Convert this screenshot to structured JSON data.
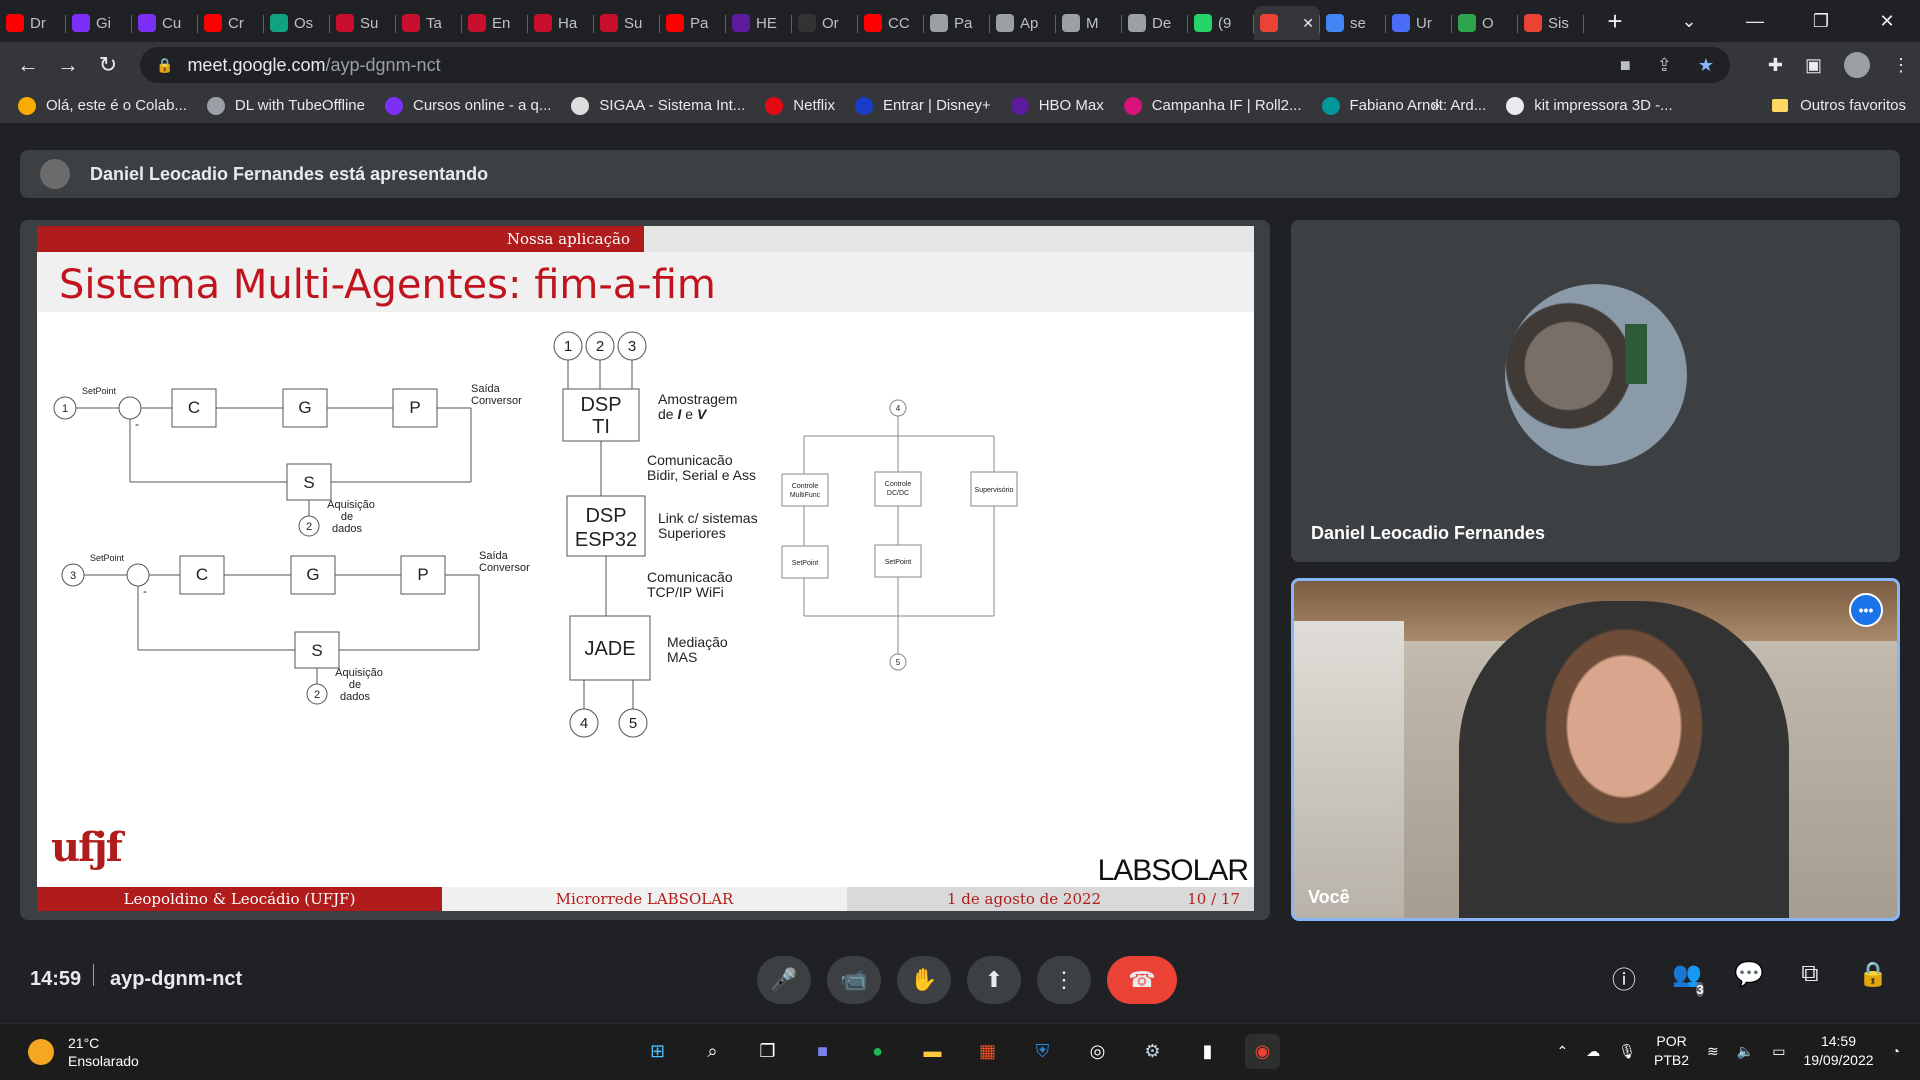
{
  "browser": {
    "tabs": [
      {
        "label": "Dr",
        "color": "#ff0000"
      },
      {
        "label": "Gi",
        "color": "#7b2ff7"
      },
      {
        "label": "Cu",
        "color": "#7b2ff7"
      },
      {
        "label": "Cr",
        "color": "#ff0000"
      },
      {
        "label": "Os",
        "color": "#10a37f"
      },
      {
        "label": "Su",
        "color": "#c8102e"
      },
      {
        "label": "Ta",
        "color": "#c8102e"
      },
      {
        "label": "En",
        "color": "#c8102e"
      },
      {
        "label": "Ha",
        "color": "#c8102e"
      },
      {
        "label": "Su",
        "color": "#c8102e"
      },
      {
        "label": "Pa",
        "color": "#ff0000"
      },
      {
        "label": "HE",
        "color": "#5c1a9d"
      },
      {
        "label": "Or",
        "color": "#333333"
      },
      {
        "label": "CC",
        "color": "#ff0000"
      },
      {
        "label": "Pa",
        "color": "#9aa0a6"
      },
      {
        "label": "Ap",
        "color": "#9aa0a6"
      },
      {
        "label": "M",
        "color": "#9aa0a6"
      },
      {
        "label": "De",
        "color": "#9aa0a6"
      },
      {
        "label": "(9",
        "color": "#25d366"
      },
      {
        "label": "",
        "color": "#ea4335",
        "active": true
      },
      {
        "label": "se",
        "color": "#4285f4"
      },
      {
        "label": "Ur",
        "color": "#4a6cf7"
      },
      {
        "label": "O",
        "color": "#2da44e"
      },
      {
        "label": "Sis",
        "color": "#ea4335"
      }
    ],
    "new_tab": "+",
    "window_controls": [
      "⌄",
      "—",
      "❐",
      "✕"
    ],
    "nav": {
      "back": "←",
      "forward": "→",
      "reload": "↻"
    },
    "url": {
      "host": "meet.google.com",
      "path": "/ayp-dgnm-nct"
    },
    "bookmarks": [
      {
        "label": "Olá, este é o Colab...",
        "color": "#f9ab00"
      },
      {
        "label": "DL with TubeOffline",
        "color": "#9aa0a6"
      },
      {
        "label": "Cursos online - a q...",
        "color": "#7b2ff7"
      },
      {
        "label": "SIGAA - Sistema Int...",
        "color": "#dddddd"
      },
      {
        "label": "Netflix",
        "color": "#e50914"
      },
      {
        "label": "Entrar | Disney+",
        "color": "#1a3cc8"
      },
      {
        "label": "HBO Max",
        "color": "#5c1a9d"
      },
      {
        "label": "Campanha IF | Roll2...",
        "color": "#d8127b"
      },
      {
        "label": "Fabiano Arndt: Ard...",
        "color": "#00979c"
      },
      {
        "label": "kit impressora 3D -...",
        "color": "#e8eaed"
      }
    ],
    "bookmarks_more": "»",
    "other_bookmarks": "Outros favoritos"
  },
  "meet": {
    "presenting_text": "Daniel Leocadio Fernandes está apresentando",
    "slide": {
      "section": "Nossa aplicação",
      "title": "Sistema Multi-Agentes:  fim-a-fim",
      "footer_authors": "Leopoldino & Leocádio  (UFJF)",
      "footer_title": "Microrrede LABSOLAR",
      "footer_date": "1 de agosto de 2022",
      "footer_page": "10 / 17",
      "logo_ufjf": "ufjf",
      "logo_labsolar": "LABSOLAR",
      "diagram": {
        "setpoint": "SetPoint",
        "saida": "Saída",
        "conversor": "Conversor",
        "aquisicao": "Aquisição",
        "de": "de",
        "dados": "dados",
        "block_c": "C",
        "block_g": "G",
        "block_p": "P",
        "block_s": "S",
        "node1": "1",
        "node2": "2",
        "node3": "3",
        "node4": "4",
        "node5": "5",
        "minus": "-",
        "dsp_ti_1": "DSP",
        "dsp_ti_2": "TI",
        "dsp_esp_1": "DSP",
        "dsp_esp_2": "ESP32",
        "jade": "JADE",
        "amostragem_1": "Amostragem",
        "amostragem_2a": "de ",
        "amostragem_i": "I",
        "amostragem_e": " e ",
        "amostragem_v": "V",
        "comun_1a": "Comunicacão",
        "comun_1b": "Bidir, Serial e Ass",
        "link_1": "Link c/ sistemas",
        "link_2": "Superiores",
        "comun_2a": "Comunicacão",
        "comun_2b": "TCP/IP WiFi",
        "mediacao_1": "Mediação",
        "mediacao_2": "MAS",
        "ctrl_multi_1": "Controle",
        "ctrl_multi_2": "MultiFunc",
        "ctrl_dc_1": "Controle",
        "ctrl_dc_2": "DC/DC",
        "supervisorio": "Supervisório",
        "setpoint_small": "SetPoint"
      }
    },
    "speaker_name": "Daniel Leocadio Fernandes",
    "self_name": "Você",
    "time": "14:59",
    "meeting_code": "ayp-dgnm-nct",
    "participants_count": "3",
    "controls": {
      "mic": "🎤",
      "camera": "📹",
      "raise_hand": "✋",
      "present": "⬆",
      "more": "⋮",
      "end_call": "☎"
    },
    "right_icons": {
      "info": "ⓘ",
      "people": "👥",
      "chat": "💬",
      "activities": "⧉",
      "host": "🔒"
    }
  },
  "taskbar": {
    "temperature": "21°C",
    "weather": "Ensolarado",
    "language": "POR",
    "layout": "PTB2",
    "time": "14:59",
    "date": "19/09/2022"
  }
}
